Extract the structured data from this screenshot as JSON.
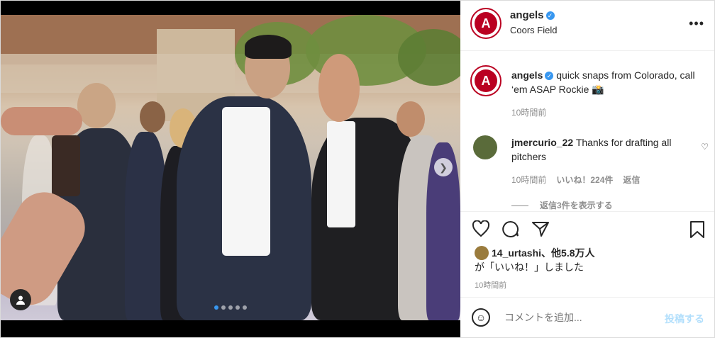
{
  "post": {
    "carousel": {
      "count": 5,
      "active": 0
    },
    "account": {
      "username": "angels",
      "location": "Coors Field",
      "avatar_logo": "A",
      "brand_color": "#ba0021"
    },
    "caption": {
      "username": "angels",
      "text": "quick snaps from Colorado, call ‘em ASAP Rockie 📸",
      "time": "10時間前"
    },
    "comment": {
      "username": "jmercurio_22",
      "text": "Thanks for drafting all pitchers",
      "time": "10時間前",
      "likes": "いいね！224件",
      "reply": "返信",
      "view_replies": "返信3件を表示する"
    },
    "likes": {
      "user": "14_urtashi",
      "count": "、他5.8万人",
      "suffix": "が「いいね！」しました"
    },
    "post_time": "10時間前",
    "add_comment": {
      "placeholder": "コメントを追加...",
      "post_label": "投稿する"
    }
  },
  "icons": {
    "verified": "verified-icon",
    "more": "more-options-icon",
    "heart": "heart-icon",
    "comment": "comment-icon",
    "share": "share-icon",
    "bookmark": "bookmark-icon",
    "emoji": "emoji-icon",
    "user_tag": "user-tag-icon",
    "next": "chevron-right-icon"
  }
}
